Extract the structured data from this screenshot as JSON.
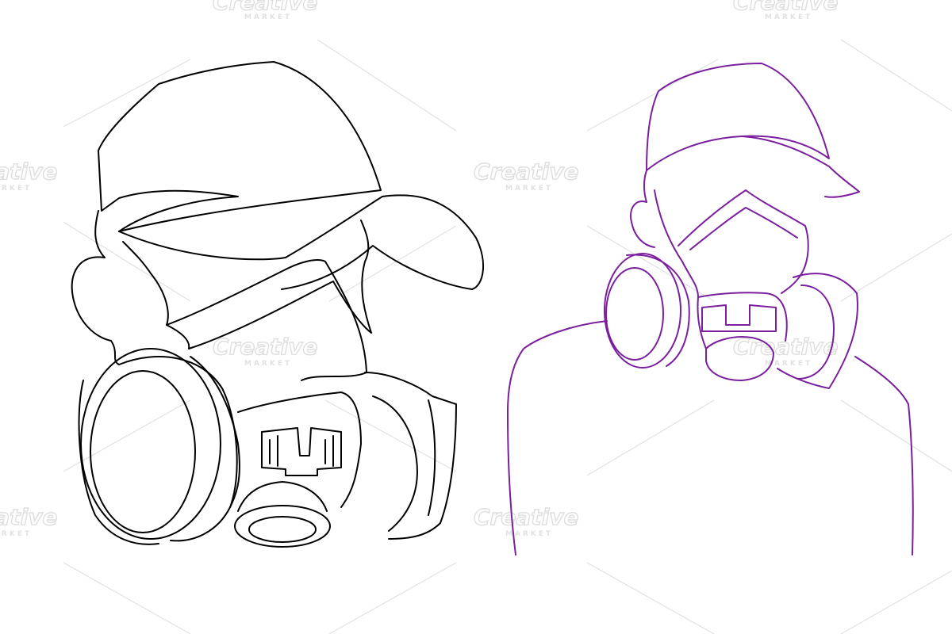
{
  "watermark": {
    "brand": "Creative",
    "sub": "MARKET"
  },
  "illustrations": [
    {
      "name": "black-outline",
      "color": "#000000",
      "subject": "respirator-mask-with-cap"
    },
    {
      "name": "purple-outline",
      "color": "#7a1f9e",
      "subject": "respirator-mask-with-cap-and-shoulders"
    }
  ],
  "colors": {
    "background": "#ffffff",
    "left_line": "#000000",
    "right_line": "#7a1f9e",
    "watermark": "#d3d3d3"
  }
}
